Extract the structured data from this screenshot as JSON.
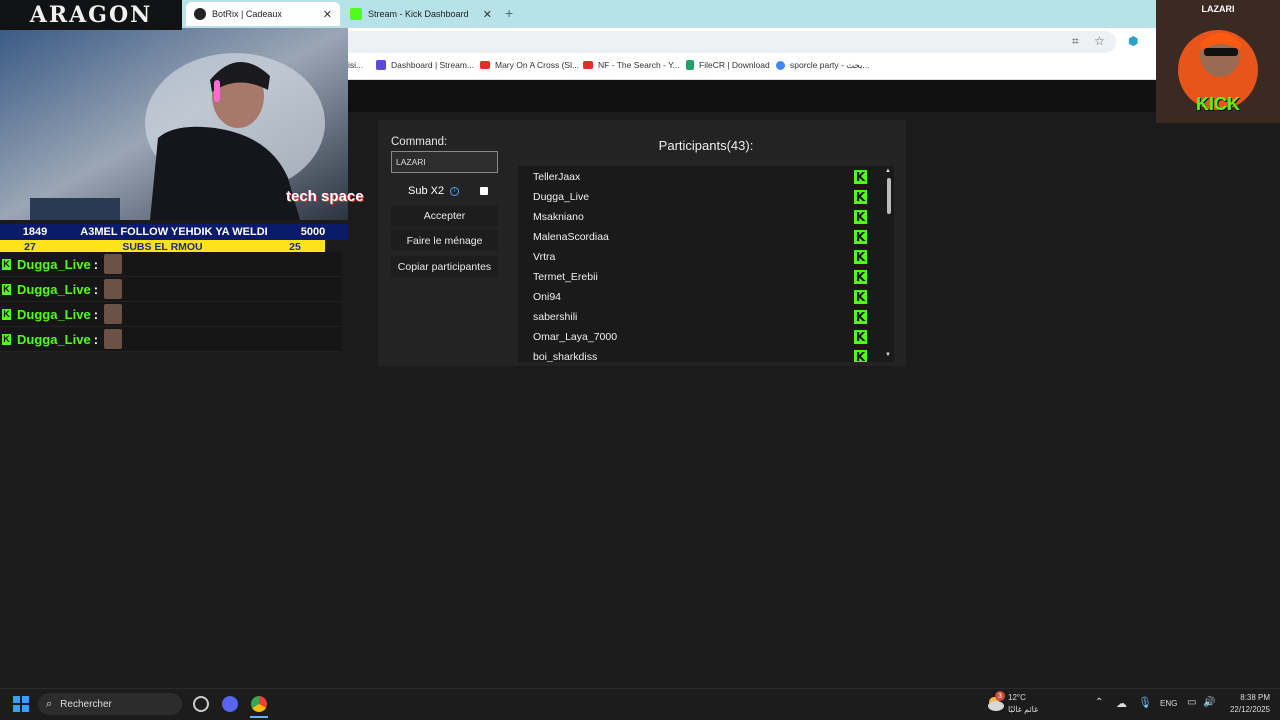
{
  "browser": {
    "tabs": [
      {
        "title": "BotRix | Cadeaux",
        "active": true
      },
      {
        "title": "Stream - Kick Dashboard",
        "active": false
      }
    ],
    "bookmarks": [
      {
        "label": "isi..."
      },
      {
        "label": "Dashboard | Stream..."
      },
      {
        "label": "Mary On A Cross (Sl..."
      },
      {
        "label": "NF - The Search - Y..."
      },
      {
        "label": "FileCR | Download"
      },
      {
        "label": "sporcle party - بحث..."
      }
    ]
  },
  "giveaway": {
    "command_label": "Command:",
    "command_value": "LAZARI",
    "sub_label": "Sub X2",
    "buttons": {
      "accept": "Accepter",
      "clear": "Faire le ménage",
      "copy": "Copiar participantes"
    },
    "participants_title": "Participants(43):",
    "participants": [
      "TellerJaax",
      "Dugga_Live",
      "Msakniano",
      "MalenaScordiaa",
      "Vrtra",
      "Termet_Erebii",
      "Oni94",
      "sabershili",
      "Omar_Laya_7000",
      "boi_sharkdiss"
    ]
  },
  "overlay": {
    "brand": "ARAGON",
    "sponsor": "tech space",
    "banner_left": "1849",
    "banner_text": "A3MEL FOLLOW YEHDIK YA WELDI",
    "banner_right": "5000",
    "subs_left": "27",
    "subs_text": "SUBS EL RMOU",
    "subs_right": "25",
    "chat": [
      {
        "user": "Dugga_Live",
        "sep": ":"
      },
      {
        "user": "Dugga_Live",
        "sep": ":"
      },
      {
        "user": "Dugga_Live",
        "sep": ":"
      },
      {
        "user": "Dugga_Live",
        "sep": ":"
      }
    ],
    "promo_name": "LAZARI",
    "promo_kick": "KICK"
  },
  "taskbar": {
    "search_placeholder": "Rechercher",
    "weather_temp": "12°C",
    "weather_desc": "غائم غالبًا",
    "weather_badge": "3",
    "language": "ENG",
    "time": "8:38 PM",
    "date": "22/12/2025"
  },
  "colors": {
    "kick_green": "#53fc18",
    "panel_bg": "#232323"
  }
}
